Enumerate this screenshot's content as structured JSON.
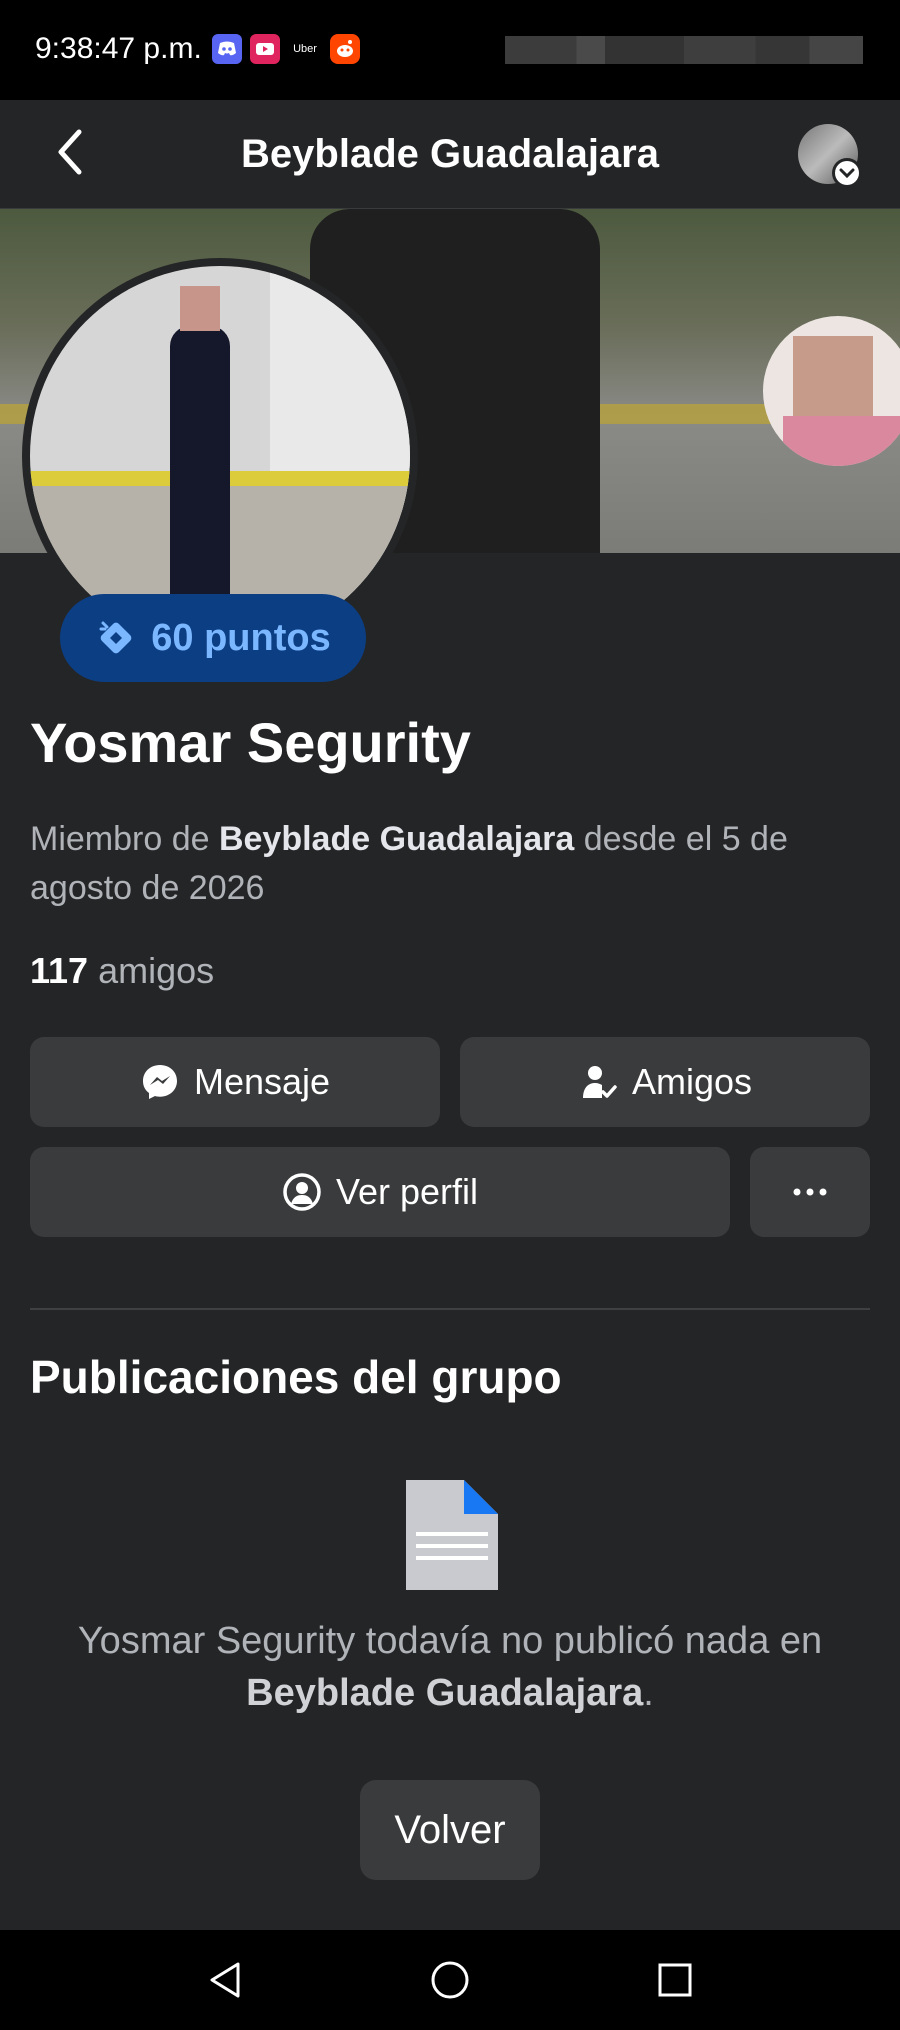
{
  "status_bar": {
    "time": "9:38:47 p.m.",
    "uber_label": "Uber"
  },
  "header": {
    "title": "Beyblade Guadalajara"
  },
  "badge": {
    "points_label": "60 puntos",
    "color": "#0c3e84",
    "text_color": "#7ab7ff"
  },
  "profile": {
    "name": "Yosmar Segurity",
    "membership_prefix": "Miembro de ",
    "membership_group": "Beyblade Guadalajara",
    "membership_suffix": " desde el 5 de agosto de 2026",
    "friends_number": "117",
    "friends_label": " amigos"
  },
  "actions": {
    "message_label": "Mensaje",
    "friends_label": "Amigos",
    "profile_label": "Ver perfil",
    "more_icon": "ellipsis-icon"
  },
  "posts": {
    "section_title": "Publicaciones del grupo",
    "empty_prefix": "Yosmar Segurity todavía no publicó nada en ",
    "empty_group": "Beyblade Guadalajara",
    "empty_suffix": ".",
    "back_label": "Volver"
  },
  "nav": {
    "icons": [
      "back-triangle-icon",
      "home-circle-icon",
      "recents-square-icon"
    ]
  }
}
